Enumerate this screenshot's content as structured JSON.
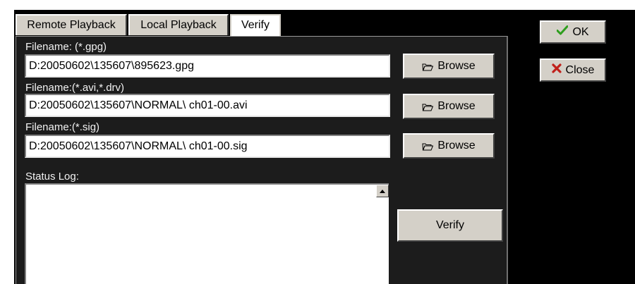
{
  "tabs": [
    {
      "label": "Remote Playback",
      "active": false
    },
    {
      "label": "Local Playback",
      "active": false
    },
    {
      "label": "Verify",
      "active": true
    }
  ],
  "fields": [
    {
      "label": "Filename: (*.gpg)",
      "value": "D:20050602\\135607\\895623.gpg"
    },
    {
      "label": "Filename:(*.avi,*.drv)",
      "value": "D:20050602\\135607\\NORMAL\\ ch01-00.avi"
    },
    {
      "label": "Filename:(*.sig)",
      "value": "D:20050602\\135607\\NORMAL\\ ch01-00.sig"
    }
  ],
  "browse_label": "Browse",
  "status": {
    "label": "Status Log:"
  },
  "verify_button": "Verify",
  "side_buttons": {
    "ok": "OK",
    "close": "Close"
  },
  "icons": {
    "browse": "folder-open-icon",
    "ok": "checkmark-icon",
    "close": "x-icon",
    "scroll_up": "scroll-up-arrow-icon"
  },
  "colors": {
    "window_bg": "#000000",
    "panel_bg": "#1c1c1c",
    "button_face": "#d4d0c8",
    "ok_check": "#2e9e1e",
    "close_x": "#c0201a"
  }
}
